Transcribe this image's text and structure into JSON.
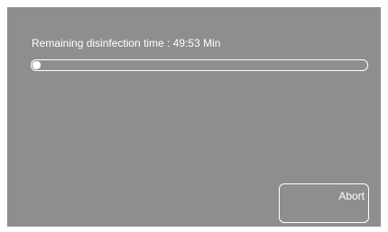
{
  "screen": {
    "background_color": "#8e8e8e",
    "foreground_color": "#ffffff"
  },
  "status": {
    "text": "Remaining disinfection time : 49:53 Min"
  },
  "progress": {
    "value": 0.02
  },
  "actions": {
    "abort_label": "Abort"
  }
}
